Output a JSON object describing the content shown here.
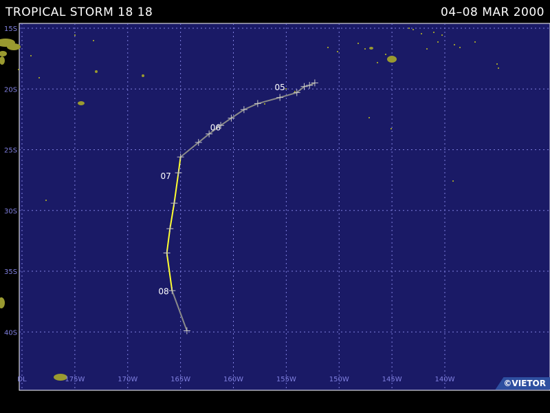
{
  "header": {
    "storm_name": "TROPICAL STORM 18 18",
    "date_range": "04–08 MAR 2000"
  },
  "map": {
    "colors": {
      "ocean": "#1a1a66",
      "grid": "#8080e0",
      "land": "#9a9a30",
      "track_weak": "#8a8a8a",
      "track_storm": "#ffff30",
      "label": "#ffffff"
    },
    "lat_labels": [
      "15S",
      "20S",
      "25S",
      "30S",
      "35S",
      "40S"
    ],
    "lon_labels": [
      "DL",
      "175W",
      "170W",
      "165W",
      "160W",
      "155W",
      "150W",
      "145W",
      "140W"
    ],
    "day_labels": [
      "05",
      "06",
      "07",
      "08"
    ],
    "track": [
      {
        "lat": -19.5,
        "lon": -152.3,
        "stage": "weak"
      },
      {
        "lat": -19.7,
        "lon": -152.8,
        "stage": "weak"
      },
      {
        "lat": -19.8,
        "lon": -153.3,
        "stage": "weak"
      },
      {
        "lat": -20.3,
        "lon": -154.0,
        "stage": "weak"
      },
      {
        "lat": -20.7,
        "lon": -155.6,
        "stage": "weak"
      },
      {
        "lat": -21.2,
        "lon": -157.7,
        "stage": "weak"
      },
      {
        "lat": -21.7,
        "lon": -159.0,
        "stage": "weak"
      },
      {
        "lat": -22.4,
        "lon": -160.2,
        "stage": "weak"
      },
      {
        "lat": -23.0,
        "lon": -161.2,
        "stage": "weak"
      },
      {
        "lat": -23.7,
        "lon": -162.3,
        "stage": "weak"
      },
      {
        "lat": -24.4,
        "lon": -163.3,
        "stage": "weak"
      },
      {
        "lat": -25.6,
        "lon": -165.0,
        "stage": "storm"
      },
      {
        "lat": -26.9,
        "lon": -165.2,
        "stage": "storm"
      },
      {
        "lat": -29.4,
        "lon": -165.6,
        "stage": "storm"
      },
      {
        "lat": -31.5,
        "lon": -166.0,
        "stage": "storm"
      },
      {
        "lat": -33.5,
        "lon": -166.3,
        "stage": "storm"
      },
      {
        "lat": -36.6,
        "lon": -165.8,
        "stage": "weak"
      },
      {
        "lat": -39.9,
        "lon": -164.4,
        "stage": "weak"
      }
    ]
  },
  "footer": {
    "credit": "©VIETOR"
  }
}
